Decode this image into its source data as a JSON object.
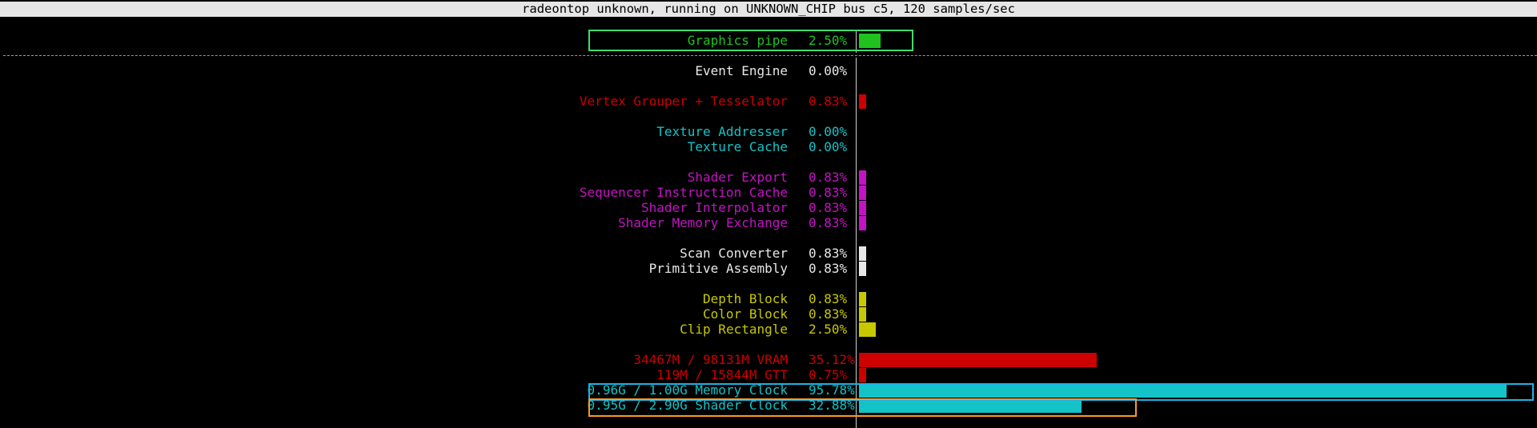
{
  "window": {
    "title": "radeontop unknown, running on UNKNOWN_CHIP bus c5, 120 samples/sec"
  },
  "colors": {
    "green": "#1fc21f",
    "white": "#e8e8e8",
    "red": "#cc0000",
    "cyan": "#14c3c8",
    "magenta": "#c413c4",
    "yellow": "#c8c800",
    "highlight_green": "#3ddc70",
    "highlight_cyan": "#18b4e6",
    "highlight_orange": "#ff9a1e"
  },
  "graphics_pipe": {
    "label": "Graphics pipe",
    "percent": "2.50%",
    "value": 2.5
  },
  "blocks": [
    {
      "label": "Event Engine",
      "percent": "0.00%",
      "value": 0.0,
      "color": "white"
    },
    {
      "label": "Vertex Grouper + Tesselator",
      "percent": "0.83%",
      "value": 0.83,
      "color": "red"
    },
    {
      "label": "Texture Addresser",
      "percent": "0.00%",
      "value": 0.0,
      "color": "cyan"
    },
    {
      "label": "Texture Cache",
      "percent": "0.00%",
      "value": 0.0,
      "color": "cyan"
    },
    {
      "label": "Shader Export",
      "percent": "0.83%",
      "value": 0.83,
      "color": "magenta"
    },
    {
      "label": "Sequencer Instruction Cache",
      "percent": "0.83%",
      "value": 0.83,
      "color": "magenta"
    },
    {
      "label": "Shader Interpolator",
      "percent": "0.83%",
      "value": 0.83,
      "color": "magenta"
    },
    {
      "label": "Shader Memory Exchange",
      "percent": "0.83%",
      "value": 0.83,
      "color": "magenta"
    },
    {
      "label": "Scan Converter",
      "percent": "0.83%",
      "value": 0.83,
      "color": "white"
    },
    {
      "label": "Primitive Assembly",
      "percent": "0.83%",
      "value": 0.83,
      "color": "white"
    },
    {
      "label": "Depth Block",
      "percent": "0.83%",
      "value": 0.83,
      "color": "yellow"
    },
    {
      "label": "Color Block",
      "percent": "0.83%",
      "value": 0.83,
      "color": "yellow"
    },
    {
      "label": "Clip Rectangle",
      "percent": "2.50%",
      "value": 2.5,
      "color": "yellow"
    },
    {
      "label": "34467M / 98131M VRAM",
      "percent": "35.12%",
      "value": 35.12,
      "color": "red"
    },
    {
      "label": "119M / 15844M GTT",
      "percent": "0.75%",
      "value": 0.75,
      "color": "red"
    },
    {
      "label": "0.96G / 1.00G Memory Clock",
      "percent": "95.78%",
      "value": 95.78,
      "color": "cyan"
    },
    {
      "label": "0.95G / 2.90G Shader Clock",
      "percent": "32.88%",
      "value": 32.88,
      "color": "cyan"
    }
  ]
}
